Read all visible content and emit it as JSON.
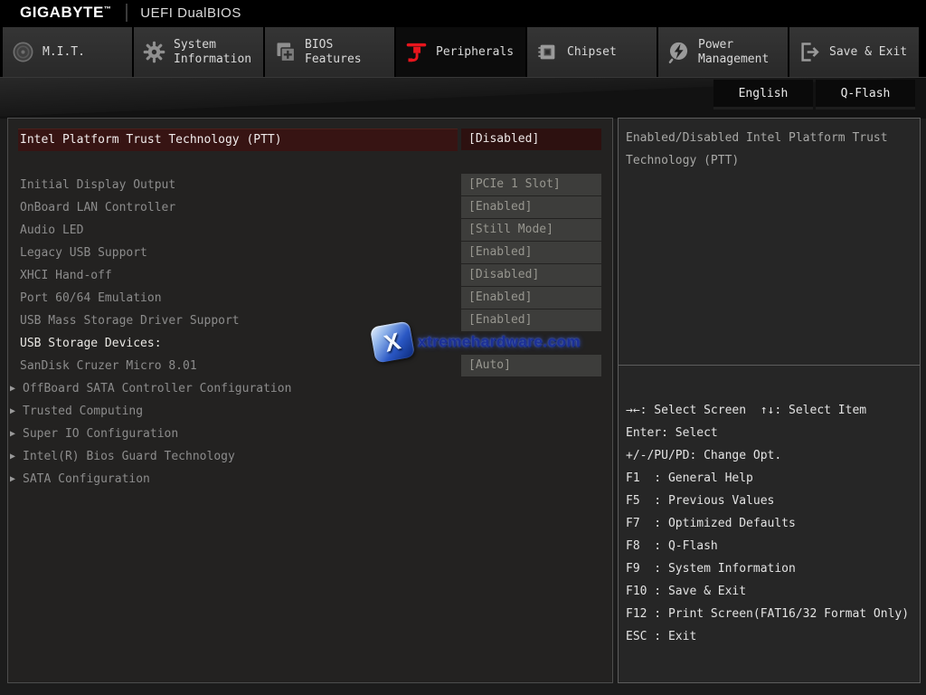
{
  "header": {
    "brand": "GIGABYTE",
    "brand_tm": "™",
    "title": "UEFI DualBIOS"
  },
  "tabs": [
    {
      "key": "mit",
      "icon": "mit-icon",
      "lines": [
        "M.I.T."
      ],
      "active": false
    },
    {
      "key": "system-information",
      "icon": "system-information-icon",
      "lines": [
        "System",
        "Information"
      ],
      "active": false
    },
    {
      "key": "bios-features",
      "icon": "bios-features-icon",
      "lines": [
        "BIOS",
        "Features"
      ],
      "active": false
    },
    {
      "key": "peripherals",
      "icon": "peripherals-icon",
      "lines": [
        "Peripherals"
      ],
      "active": true
    },
    {
      "key": "chipset",
      "icon": "chipset-icon",
      "lines": [
        "Chipset"
      ],
      "active": false
    },
    {
      "key": "power-management",
      "icon": "power-management-icon",
      "lines": [
        "Power",
        "Management"
      ],
      "active": false
    },
    {
      "key": "save-exit",
      "icon": "save-exit-icon",
      "lines": [
        "Save & Exit"
      ],
      "active": false
    }
  ],
  "toolbar": {
    "language_button": "English",
    "qflash_button": "Q-Flash"
  },
  "settings": {
    "rows": [
      {
        "type": "selected",
        "label": "Intel Platform Trust Technology (PTT)",
        "value": "[Disabled]"
      },
      {
        "type": "blank"
      },
      {
        "type": "normal",
        "label": "Initial Display Output",
        "value": "[PCIe 1 Slot]"
      },
      {
        "type": "normal",
        "label": "OnBoard LAN Controller",
        "value": "[Enabled]"
      },
      {
        "type": "normal",
        "label": "Audio LED",
        "value": "[Still Mode]"
      },
      {
        "type": "normal",
        "label": "Legacy USB Support",
        "value": "[Enabled]"
      },
      {
        "type": "normal",
        "label": "XHCI Hand-off",
        "value": "[Disabled]"
      },
      {
        "type": "normal",
        "label": "Port 60/64 Emulation",
        "value": "[Enabled]"
      },
      {
        "type": "normal",
        "label": "USB Mass Storage Driver Support",
        "value": "[Enabled]"
      },
      {
        "type": "header",
        "label": "USB Storage Devices:"
      },
      {
        "type": "normal",
        "label": "SanDisk Cruzer Micro 8.01",
        "value": "[Auto]"
      },
      {
        "type": "submenu",
        "label": "OffBoard SATA Controller Configuration"
      },
      {
        "type": "submenu",
        "label": "Trusted Computing"
      },
      {
        "type": "submenu",
        "label": "Super IO Configuration"
      },
      {
        "type": "submenu",
        "label": "Intel(R) Bios Guard Technology"
      },
      {
        "type": "submenu",
        "label": "SATA Configuration"
      }
    ],
    "submenu_marker": "▶"
  },
  "help": {
    "text": "Enabled/Disabled Intel Platform Trust Technology (PTT)"
  },
  "legend": {
    "lines": [
      "→←: Select Screen  ↑↓: Select Item",
      "Enter: Select",
      "+/-/PU/PD: Change Opt.",
      "F1  : General Help",
      "F5  : Previous Values",
      "F7  : Optimized Defaults",
      "F8  : Q-Flash",
      "F9  : System Information",
      "F10 : Save & Exit",
      "F12 : Print Screen(FAT16/32 Format Only)",
      "ESC : Exit"
    ]
  },
  "watermark": {
    "x_glyph": "X",
    "text": "xtremehardware.com"
  },
  "colors": {
    "accent_red": "#e8151d",
    "selected_row_bg": "#371413",
    "selected_value_bg": "#2d1110",
    "value_box_bg": "#3d3d3b",
    "panel_border": "#5d5d5d",
    "watermark_blue": "#1b2f96"
  }
}
